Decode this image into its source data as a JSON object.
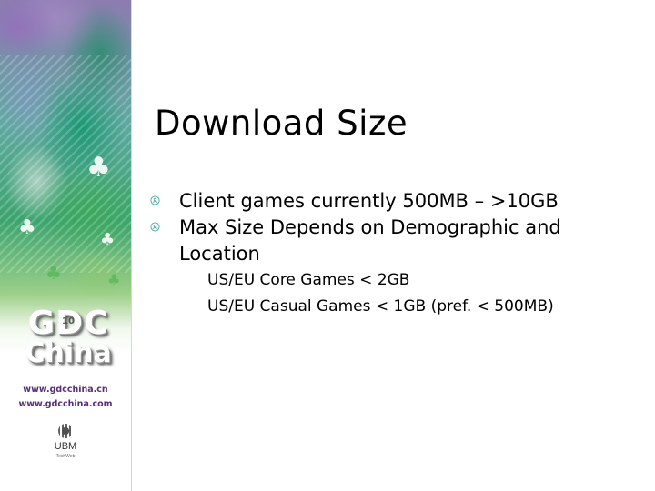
{
  "slide": {
    "title": "Download Size",
    "bullets": [
      {
        "text": "Client games currently 500MB – >10GB",
        "level": 1,
        "icon": "circle-bullet-icon"
      },
      {
        "text": "Max Size Depends on Demographic and Location",
        "level": 1,
        "icon": "circle-bullet-icon"
      }
    ],
    "sub_bullets": [
      {
        "text": "US/EU Core Games < 2GB",
        "level": 2
      },
      {
        "text": "US/EU Casual Games < 1GB (pref. < 500MB)",
        "level": 2
      }
    ]
  },
  "sidebar": {
    "logo_main": "GDC",
    "logo_edition": "10",
    "logo_sub": "China",
    "urls": [
      "www.gdcchina.cn",
      "www.gdcchina.com"
    ],
    "sponsor": "UBM",
    "sponsor_sub": "TechWeb"
  },
  "colors": {
    "bullet": "#4aa6a0",
    "url_text": "#5a2f7a",
    "title_text": "#000000"
  }
}
